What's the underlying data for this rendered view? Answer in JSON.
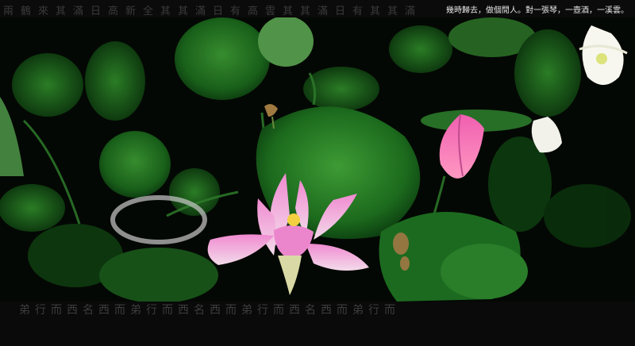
{
  "caption": "幾時歸去，做個閒人。對一張琴，一壺酒，一溪雲。",
  "watermark_top": "兩鶴來其滿日高新全其其滿日有高雲其其滿日有其其滿",
  "watermark_bottom": "弟行而西名西而弟行而西名西而弟行而西名西而弟行而",
  "colors": {
    "background": "#000000",
    "leaf_dark": "#0f3a12",
    "leaf_mid": "#1f6b22",
    "leaf_light": "#3f9a35",
    "lotus_pink": "#e06fb8",
    "lotus_white": "#f7f7ef"
  }
}
